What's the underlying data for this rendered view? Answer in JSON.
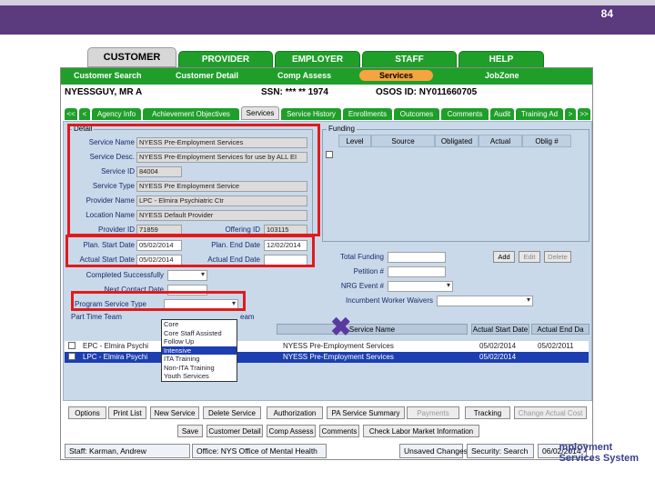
{
  "page_number": "84",
  "main_tabs": [
    "CUSTOMER",
    "PROVIDER",
    "EMPLOYER",
    "STAFF",
    "HELP"
  ],
  "sub_nav": [
    "Customer Search",
    "Customer Detail",
    "Comp Assess",
    "Services",
    "JobZone"
  ],
  "person": {
    "name": "NYESSGUY, MR A",
    "ssn": "SSN: *** ** 1974",
    "osos": "OSOS ID: NY011660705"
  },
  "sub_tabs": [
    "<<",
    "<",
    "Agency Info",
    "Achievement Objectives",
    "Services",
    "Service History",
    "Enrollments",
    "Outcomes",
    "Comments",
    "Audit",
    "Training Ad",
    ">",
    ">>"
  ],
  "detail": {
    "legend": "Detail",
    "fields": [
      {
        "label": "Service Name",
        "value": "NYESS Pre-Employment Services"
      },
      {
        "label": "Service Desc.",
        "value": "NYESS Pre-Employment Services for use by ALL EI"
      },
      {
        "label": "Service ID",
        "value": "84004"
      },
      {
        "label": "Service Type",
        "value": "NYESS Pre Employment Service"
      },
      {
        "label": "Provider Name",
        "value": "LPC - Elmira Psychiatric Ctr"
      },
      {
        "label": "Location Name",
        "value": "NYESS Default Provider"
      },
      {
        "label": "Provider ID",
        "value": "71859"
      }
    ],
    "offering_label": "Offering ID",
    "offering_value": "103115",
    "plan_start_label": "Plan. Start Date",
    "plan_start_value": "05/02/2014",
    "plan_end_label": "Plan. End Date",
    "plan_end_value": "12/02/2014",
    "actual_start_label": "Actual Start Date",
    "actual_start_value": "05/02/2014",
    "actual_end_label": "Actual End Date",
    "completed_label": "Completed Successfully",
    "next_contact_label": "Next Contact Date",
    "program_type_label": "Program Service Type",
    "part_time_label": "Part Time Team",
    "team_label": "eam"
  },
  "funding": {
    "legend": "Funding",
    "headers": [
      "Level",
      "Source",
      "Obligated",
      "Actual",
      "Oblig #"
    ],
    "total_label": "Total Funding",
    "petition_label": "Petition #",
    "nrg_label": "NRG Event #",
    "incumbent_label": "Incumbent Worker Waivers",
    "buttons": [
      "Add",
      "Edit",
      "Delete"
    ]
  },
  "dropdown_options": [
    "Core",
    "Core Staff Assisted",
    "Follow Up",
    "Intensive",
    "ITA Training",
    "Non-ITA Training",
    "Youth Services"
  ],
  "dropdown_selected_index": 3,
  "grid": {
    "headers": [
      "Service Name",
      "Actual Start Date",
      "Actual End Da"
    ],
    "rows": [
      {
        "provider": "EPC - Elmira Psychi",
        "service": "NYESS Pre-Employment Services",
        "start": "05/02/2014",
        "end": "05/02/2011"
      },
      {
        "provider": "LPC - Elmira Psychi",
        "service": "NYESS Pre-Employment Services",
        "start": "05/02/2014",
        "end": ""
      }
    ]
  },
  "action_buttons": [
    "Options",
    "Print List",
    "New Service",
    "Delete Service",
    "Authorization",
    "PA Service Summary",
    "Payments",
    "Tracking",
    "Change Actual Cost"
  ],
  "bottom_buttons": [
    "Save",
    "Customer Detail",
    "Comp Assess",
    "Comments",
    "Check Labor Market Information"
  ],
  "status_bar": {
    "staff": "Staff: Karman, Andrew",
    "office": "Office: NYS Office of Mental Health",
    "unsaved": "Unsaved Changes",
    "security": "Security: Search",
    "date": "06/02/2014"
  },
  "brand_lines": [
    "mployment",
    "Services System"
  ],
  "colors": {
    "header": "#5b3a7e",
    "nav_green": "#1f9f2a",
    "highlight": "#e01b1b",
    "active_sub": "#f5a440",
    "selection": "#1c3eb0"
  }
}
